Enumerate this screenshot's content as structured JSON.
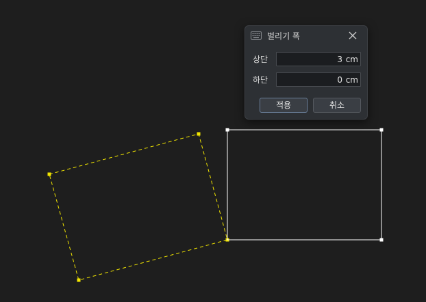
{
  "dialog": {
    "title": "벌리기 폭",
    "icon": "keyboard-icon",
    "top": {
      "label": "상단",
      "value": "3",
      "unit": "cm"
    },
    "bottom": {
      "label": "하단",
      "value": "0",
      "unit": "cm"
    },
    "apply_label": "적용",
    "cancel_label": "취소"
  },
  "colors": {
    "canvas_background": "#1e1e1e",
    "rotated_outline": "#f2e600",
    "selected_outline": "#ffffff",
    "dialog_background": "#2d3034"
  }
}
